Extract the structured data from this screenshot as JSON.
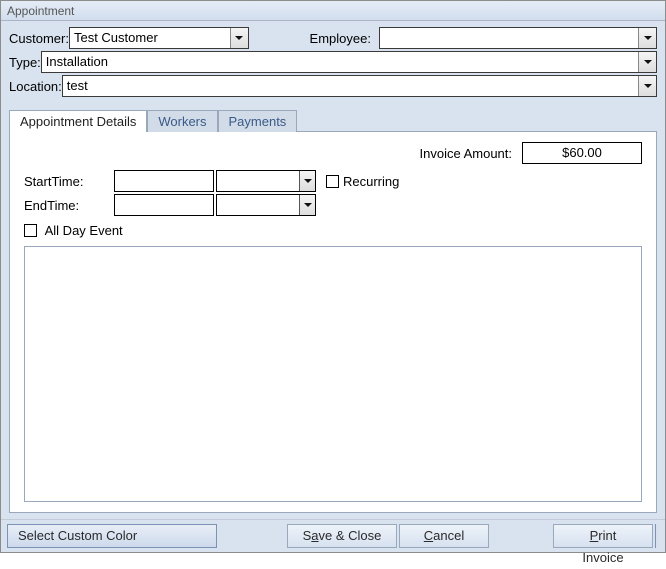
{
  "window": {
    "title": "Appointment"
  },
  "header": {
    "customer_label": "Customer:",
    "customer_value": "Test Customer",
    "employee_label": "Employee:",
    "employee_value": "",
    "type_label": "Type:",
    "type_value": "Installation",
    "location_label": "Location:",
    "location_value": "test"
  },
  "tabs": {
    "details": "Appointment Details",
    "workers": "Workers",
    "payments": "Payments"
  },
  "details": {
    "invoice_label": "Invoice Amount:",
    "invoice_value": "$60.00",
    "start_label": "StartTime:",
    "start_date": "",
    "start_time": "",
    "end_label": "EndTime:",
    "end_date": "",
    "end_time": "",
    "recurring_label": "Recurring",
    "allday_label": "All Day Event",
    "notes": ""
  },
  "footer": {
    "select_color": "Select Custom Color",
    "save_pre": "S",
    "save_u": "a",
    "save_post": "ve & Close",
    "cancel_u": "C",
    "cancel_post": "ancel",
    "print_u": "P",
    "print_post": "rint Invoice"
  }
}
